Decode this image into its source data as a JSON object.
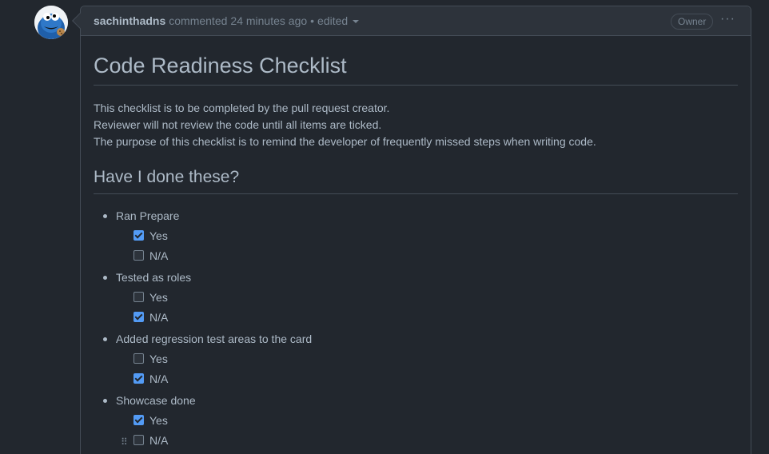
{
  "comment": {
    "author": "sachinthadns",
    "action": "commented",
    "time": "24 minutes ago",
    "separator": "•",
    "edited": "edited",
    "role_badge": "Owner",
    "menu_glyph": "···"
  },
  "doc": {
    "title": "Code Readiness Checklist",
    "intro": [
      "This checklist is to be completed by the pull request creator.",
      "Reviewer will not review the code until all items are ticked.",
      "The purpose of this checklist is to remind the developer of frequently missed steps when writing code."
    ],
    "subtitle": "Have I done these?",
    "items": [
      {
        "label": "Ran Prepare",
        "options": [
          {
            "label": "Yes",
            "checked": true
          },
          {
            "label": "N/A",
            "checked": false
          }
        ]
      },
      {
        "label": "Tested as roles",
        "options": [
          {
            "label": "Yes",
            "checked": false
          },
          {
            "label": "N/A",
            "checked": true
          }
        ]
      },
      {
        "label": "Added regression test areas to the card",
        "options": [
          {
            "label": "Yes",
            "checked": false
          },
          {
            "label": "N/A",
            "checked": true
          }
        ]
      },
      {
        "label": "Showcase done",
        "options": [
          {
            "label": "Yes",
            "checked": true
          },
          {
            "label": "N/A",
            "checked": false
          }
        ]
      }
    ]
  },
  "icons": {
    "avatar": "cookie-monster-avatar-icon",
    "drag": "drag-handle-icon",
    "caret": "chevron-down-icon",
    "kebab": "kebab-menu-icon"
  },
  "colors": {
    "background": "#22272e",
    "header": "#2d333b",
    "border": "#444c56",
    "accent": "#539bf5",
    "text": "#adbac7",
    "muted": "#768390"
  }
}
